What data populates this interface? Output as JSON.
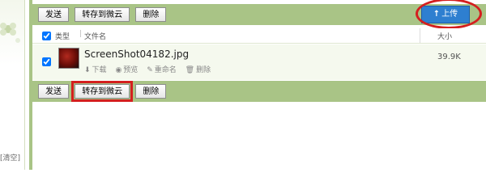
{
  "sidebar": {
    "clear_link": "[清空]"
  },
  "toolbar_top": {
    "send_label": "发送",
    "save_to_weiyun_label": "转存到微云",
    "delete_label": "删除"
  },
  "toolbar_bottom": {
    "send_label": "发送",
    "save_to_weiyun_label": "转存到微云",
    "delete_label": "删除"
  },
  "upload": {
    "label": "上传"
  },
  "table": {
    "header": {
      "type_label": "类型",
      "name_label": "文件名",
      "size_label": "大小"
    },
    "rows": [
      {
        "name": "ScreenShot04182.jpg",
        "size": "39.9K",
        "actions": {
          "download": "下载",
          "preview": "预览",
          "rename": "重命名",
          "delete": "删除"
        }
      }
    ]
  },
  "colors": {
    "toolbar_bg": "#a9c486",
    "upload_bg": "#2e7fd0",
    "highlight_red": "#d41f1f",
    "row_bg": "#f5f9ee"
  }
}
